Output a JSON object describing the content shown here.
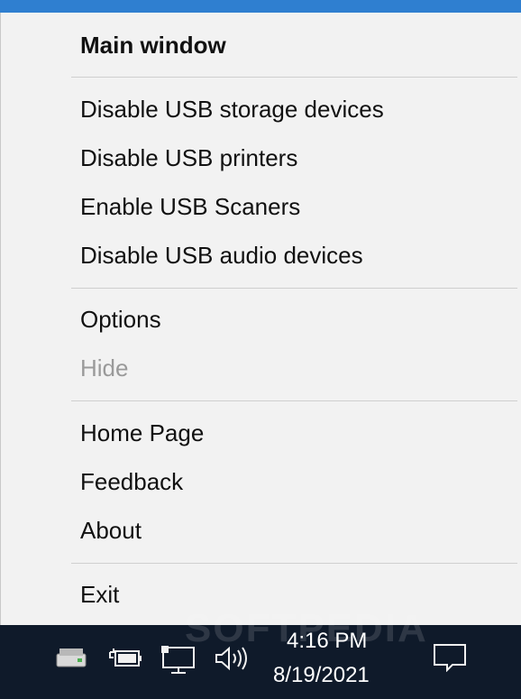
{
  "menu": {
    "items": [
      {
        "label": "Main window",
        "bold": true
      },
      {
        "label": "Disable USB storage devices"
      },
      {
        "label": "Disable USB printers"
      },
      {
        "label": "Enable USB Scaners"
      },
      {
        "label": "Disable USB audio devices"
      },
      {
        "label": "Options"
      },
      {
        "label": "Hide",
        "disabled": true
      },
      {
        "label": "Home Page"
      },
      {
        "label": "Feedback"
      },
      {
        "label": "About"
      },
      {
        "label": "Exit"
      }
    ]
  },
  "taskbar": {
    "tray_icons": [
      "usb-drive-icon",
      "battery-icon",
      "network-icon",
      "volume-icon"
    ],
    "time": "4:16 PM",
    "date": "8/19/2021",
    "notification_icon": "action-center-icon"
  },
  "watermark": "SOFTPEDIA",
  "colors": {
    "menu_bg": "#f2f2f2",
    "taskbar_bg": "#0f1a2a",
    "disabled_text": "#9a9a9a"
  }
}
